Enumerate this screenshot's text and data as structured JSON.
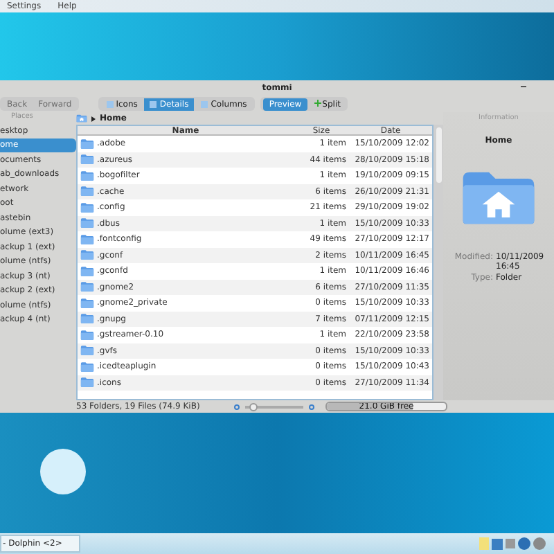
{
  "menu": [
    "Settings",
    "Help"
  ],
  "window": {
    "title": "tommi"
  },
  "toolbar": {
    "nav": [
      {
        "label": "Back",
        "disabled": true
      },
      {
        "label": "Forward",
        "disabled": true
      }
    ],
    "views": [
      {
        "label": "Icons",
        "selected": false
      },
      {
        "label": "Details",
        "selected": true
      },
      {
        "label": "Columns",
        "selected": false
      }
    ],
    "preview": {
      "label": "Preview",
      "on": true
    },
    "split": {
      "label": "Split"
    }
  },
  "places": {
    "title": "Places",
    "items": [
      {
        "label": "esktop",
        "selected": false
      },
      {
        "label": "ome",
        "selected": true
      },
      {
        "label": "ocuments",
        "selected": false
      },
      {
        "label": "ab_downloads",
        "selected": false
      },
      {
        "label": "etwork",
        "selected": false
      },
      {
        "label": "oot",
        "selected": false
      },
      {
        "label": "astebin",
        "selected": false
      },
      {
        "label": "olume (ext3)",
        "selected": false
      },
      {
        "label": "ackup 1 (ext)",
        "selected": false
      },
      {
        "label": "olume (ntfs)",
        "selected": false
      },
      {
        "label": "ackup 3 (nt)",
        "selected": false
      },
      {
        "label": "ackup 2 (ext)",
        "selected": false
      },
      {
        "label": "olume (ntfs)",
        "selected": false
      },
      {
        "label": "ackup 4 (nt)",
        "selected": false
      }
    ]
  },
  "breadcrumb": "Home",
  "table": {
    "columns": [
      "Name",
      "Size",
      "Date"
    ],
    "rows": [
      {
        "name": ".adobe",
        "size": "1 item",
        "date": "15/10/2009 12:02"
      },
      {
        "name": ".azureus",
        "size": "44 items",
        "date": "28/10/2009 15:18"
      },
      {
        "name": ".bogofilter",
        "size": "1 item",
        "date": "19/10/2009 09:15"
      },
      {
        "name": ".cache",
        "size": "6 items",
        "date": "26/10/2009 21:31"
      },
      {
        "name": ".config",
        "size": "21 items",
        "date": "29/10/2009 19:02"
      },
      {
        "name": ".dbus",
        "size": "1 item",
        "date": "15/10/2009 10:33"
      },
      {
        "name": ".fontconfig",
        "size": "49 items",
        "date": "27/10/2009 12:17"
      },
      {
        "name": ".gconf",
        "size": "2 items",
        "date": "10/11/2009 16:45"
      },
      {
        "name": ".gconfd",
        "size": "1 item",
        "date": "10/11/2009 16:46"
      },
      {
        "name": ".gnome2",
        "size": "6 items",
        "date": "27/10/2009 11:35"
      },
      {
        "name": ".gnome2_private",
        "size": "0 items",
        "date": "15/10/2009 10:33"
      },
      {
        "name": ".gnupg",
        "size": "7 items",
        "date": "07/11/2009 12:15"
      },
      {
        "name": ".gstreamer-0.10",
        "size": "1 item",
        "date": "22/10/2009 23:58"
      },
      {
        "name": ".gvfs",
        "size": "0 items",
        "date": "15/10/2009 10:33"
      },
      {
        "name": ".icedteaplugin",
        "size": "0 items",
        "date": "15/10/2009 10:43"
      },
      {
        "name": ".icons",
        "size": "0 items",
        "date": "27/10/2009 11:34"
      }
    ]
  },
  "status": {
    "text": "53 Folders, 19 Files (74.9 KiB)",
    "zoom": {
      "level": 0.08
    },
    "free": {
      "text": "21.0 GiB free",
      "level": 0.72
    }
  },
  "info": {
    "title": "Information",
    "name": "Home",
    "fields": [
      {
        "label": "Modified:",
        "value": "10/11/2009 16:45"
      },
      {
        "label": "Type:",
        "value": "Folder"
      }
    ]
  },
  "taskbar": {
    "task": "- Dolphin <2>"
  }
}
